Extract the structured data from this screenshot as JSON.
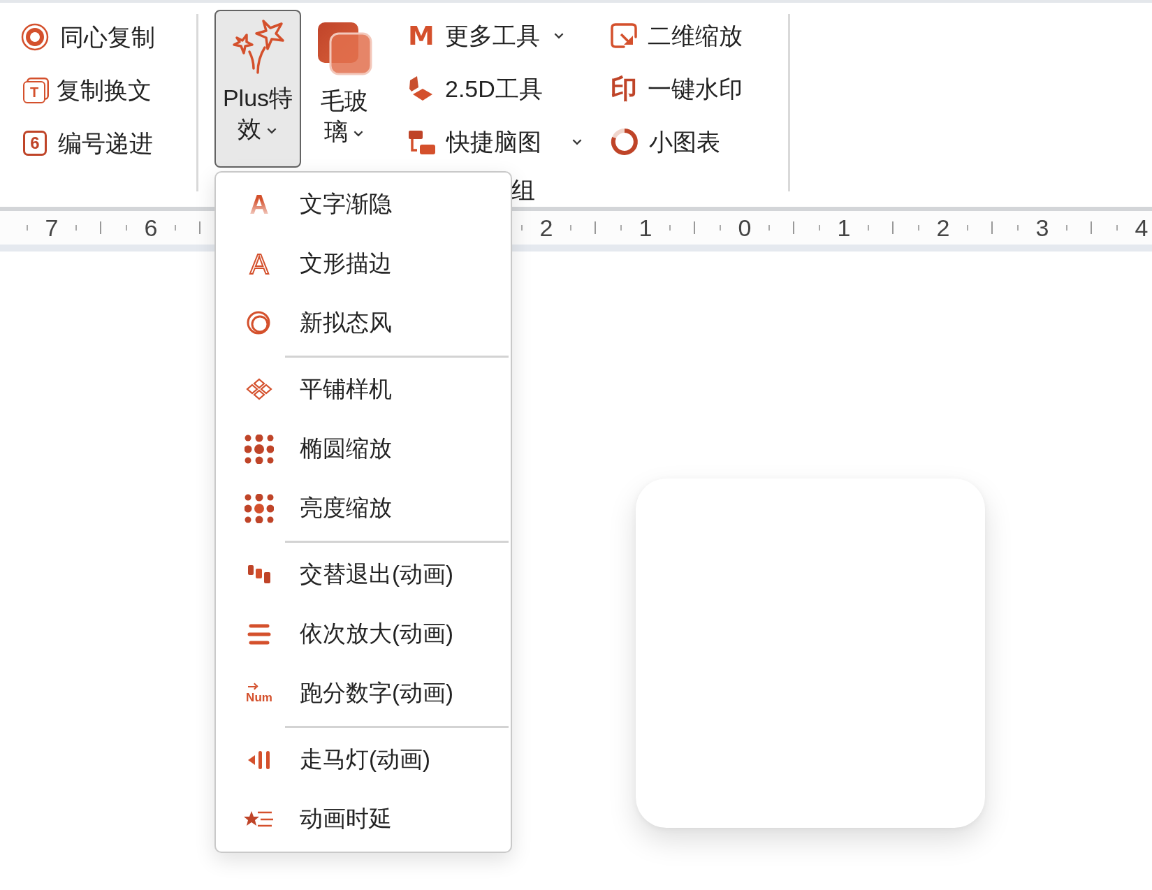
{
  "ribbon": {
    "copy_tools": [
      {
        "label": "同心复制"
      },
      {
        "label": "复制换文",
        "icon_text": "T"
      },
      {
        "label": "编号递进",
        "icon_text": "6"
      }
    ],
    "large_buttons": [
      {
        "label": "Plus特效",
        "pressed": true,
        "has_dropdown": true
      },
      {
        "label": "毛玻璃",
        "pressed": false,
        "has_dropdown": true
      }
    ],
    "tools_column_1": [
      {
        "label": "更多工具",
        "icon_text": "M",
        "has_dropdown": true
      },
      {
        "label": "2.5D工具",
        "has_dropdown": false
      },
      {
        "label": "快捷脑图",
        "has_dropdown": true
      }
    ],
    "tools_column_2": [
      {
        "label": "二维缩放"
      },
      {
        "label": "一键水印",
        "icon_text": "印"
      },
      {
        "label": "小图表"
      }
    ],
    "group_label": "组"
  },
  "ruler": {
    "left_labels": [
      "7",
      "6"
    ],
    "right_labels": [
      "2",
      "1",
      "0",
      "1",
      "2",
      "3",
      "4"
    ]
  },
  "plus_menu": {
    "sections": [
      [
        {
          "label": "文字渐隐",
          "icon_text": "A"
        },
        {
          "label": "文形描边",
          "icon_text": "A"
        },
        {
          "label": "新拟态风"
        }
      ],
      [
        {
          "label": "平铺样机"
        },
        {
          "label": "椭圆缩放"
        },
        {
          "label": "亮度缩放"
        }
      ],
      [
        {
          "label": "交替退出(动画)"
        },
        {
          "label": "依次放大(动画)"
        },
        {
          "label": "跑分数字(动画)",
          "icon_text": "Num"
        }
      ],
      [
        {
          "label": "走马灯(动画)"
        },
        {
          "label": "动画时延"
        }
      ]
    ]
  }
}
